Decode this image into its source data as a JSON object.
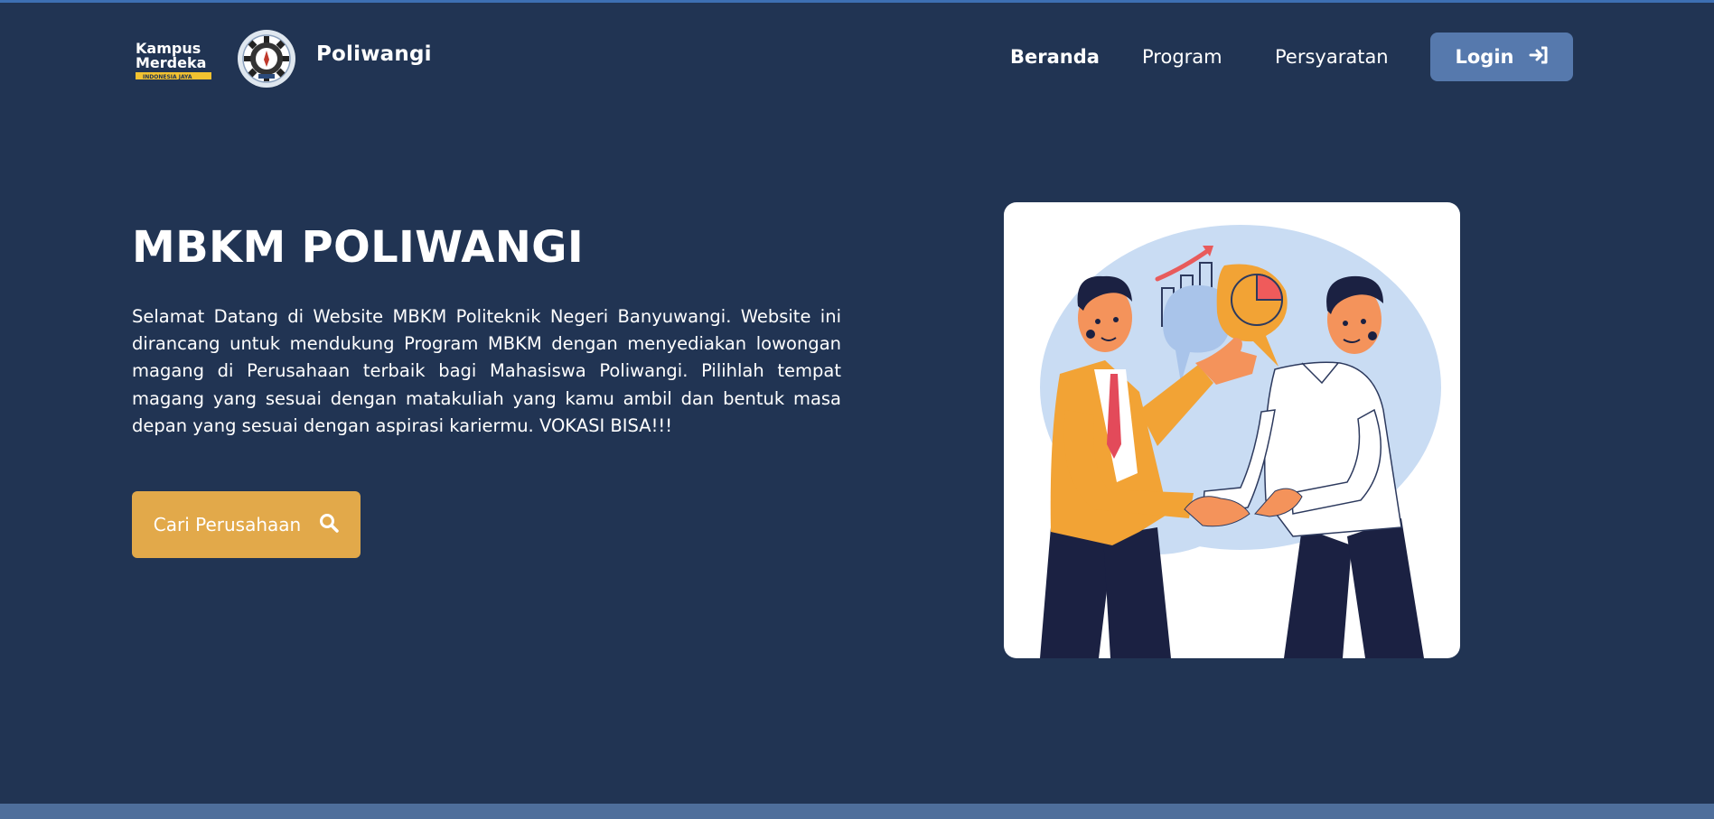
{
  "nav": {
    "brand": "Poliwangi",
    "links": [
      "Beranda",
      "Program",
      "Persyaratan"
    ],
    "login_label": "Login"
  },
  "logo_kampus_merdeka": {
    "line1": "Kampus",
    "line2": "Merdeka",
    "tagline": "INDONESIA JAYA"
  },
  "hero": {
    "title": "MBKM POLIWANGI",
    "description": "Selamat Datang di Website MBKM Politeknik Negeri Banyuwangi. Website ini dirancang untuk mendukung Program MBKM dengan menyediakan lowongan magang di Perusahaan terbaik bagi Mahasiswa Poliwangi. Pilihlah tempat magang yang sesuai dengan matakuliah yang kamu ambil dan bentuk masa depan yang sesuai dengan aspirasi kariermu. VOKASI BISA!!!",
    "cta_label": "Cari Perusahaan"
  },
  "colors": {
    "background": "#213453",
    "login_button": "#5679ad",
    "cta_button": "#e2a94a",
    "bottom_strip": "#4e6e9b"
  },
  "icons": {
    "login": "sign-in-icon",
    "cta": "search-icon"
  }
}
